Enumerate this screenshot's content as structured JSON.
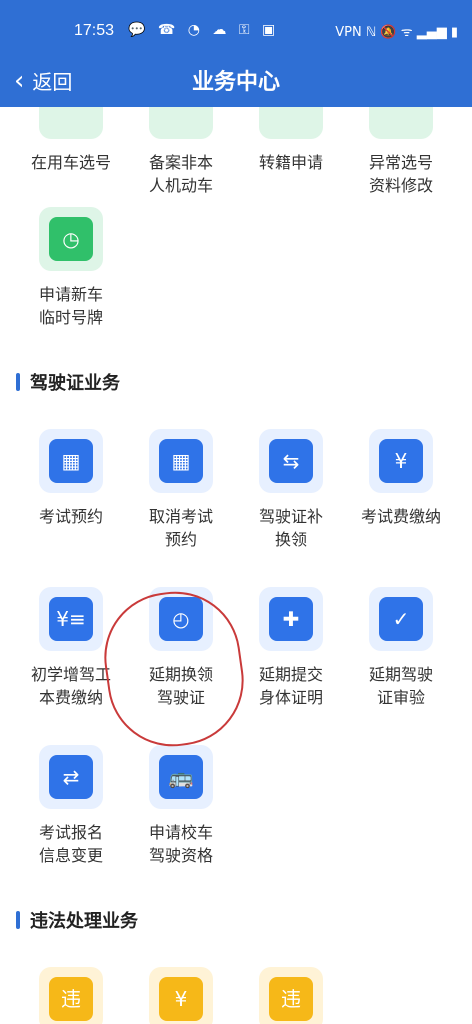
{
  "status_bar": {
    "time": "17:53",
    "vpn": "VPN"
  },
  "header": {
    "back_label": "返回",
    "title": "业务中心"
  },
  "top_row": [
    {
      "label": "在用车选号"
    },
    {
      "label": "备案非本\n人机动车"
    },
    {
      "label": "转籍申请"
    },
    {
      "label": "异常选号\n资料修改"
    }
  ],
  "vehicle_more": [
    {
      "label": "申请新车\n临时号牌",
      "icon": "cash-icon"
    }
  ],
  "license_section": {
    "title": "驾驶证业务",
    "items": [
      {
        "label": "考试预约",
        "icon": "calendar-icon"
      },
      {
        "label": "取消考试\n预约",
        "icon": "calendar-icon"
      },
      {
        "label": "驾驶证补\n换领",
        "icon": "license-swap-icon"
      },
      {
        "label": "考试费缴纳",
        "icon": "receipt-icon"
      },
      {
        "label": "初学增驾工\n本费缴纳",
        "icon": "yen-list-icon"
      },
      {
        "label": "延期换领\n驾驶证",
        "icon": "license-clock-icon"
      },
      {
        "label": "延期提交\n身体证明",
        "icon": "medical-upload-icon"
      },
      {
        "label": "延期驾驶\n证审验",
        "icon": "license-check-icon"
      },
      {
        "label": "考试报名\n信息变更",
        "icon": "id-swap-icon"
      },
      {
        "label": "申请校车\n驾驶资格",
        "icon": "bus-icon"
      }
    ]
  },
  "violation_section": {
    "title": "违法处理业务",
    "items": [
      {
        "icon": "search-violation-icon",
        "glyph": "违"
      },
      {
        "icon": "yen-receipt-icon",
        "glyph": "¥"
      },
      {
        "icon": "hand-violation-icon",
        "glyph": "违"
      }
    ]
  }
}
